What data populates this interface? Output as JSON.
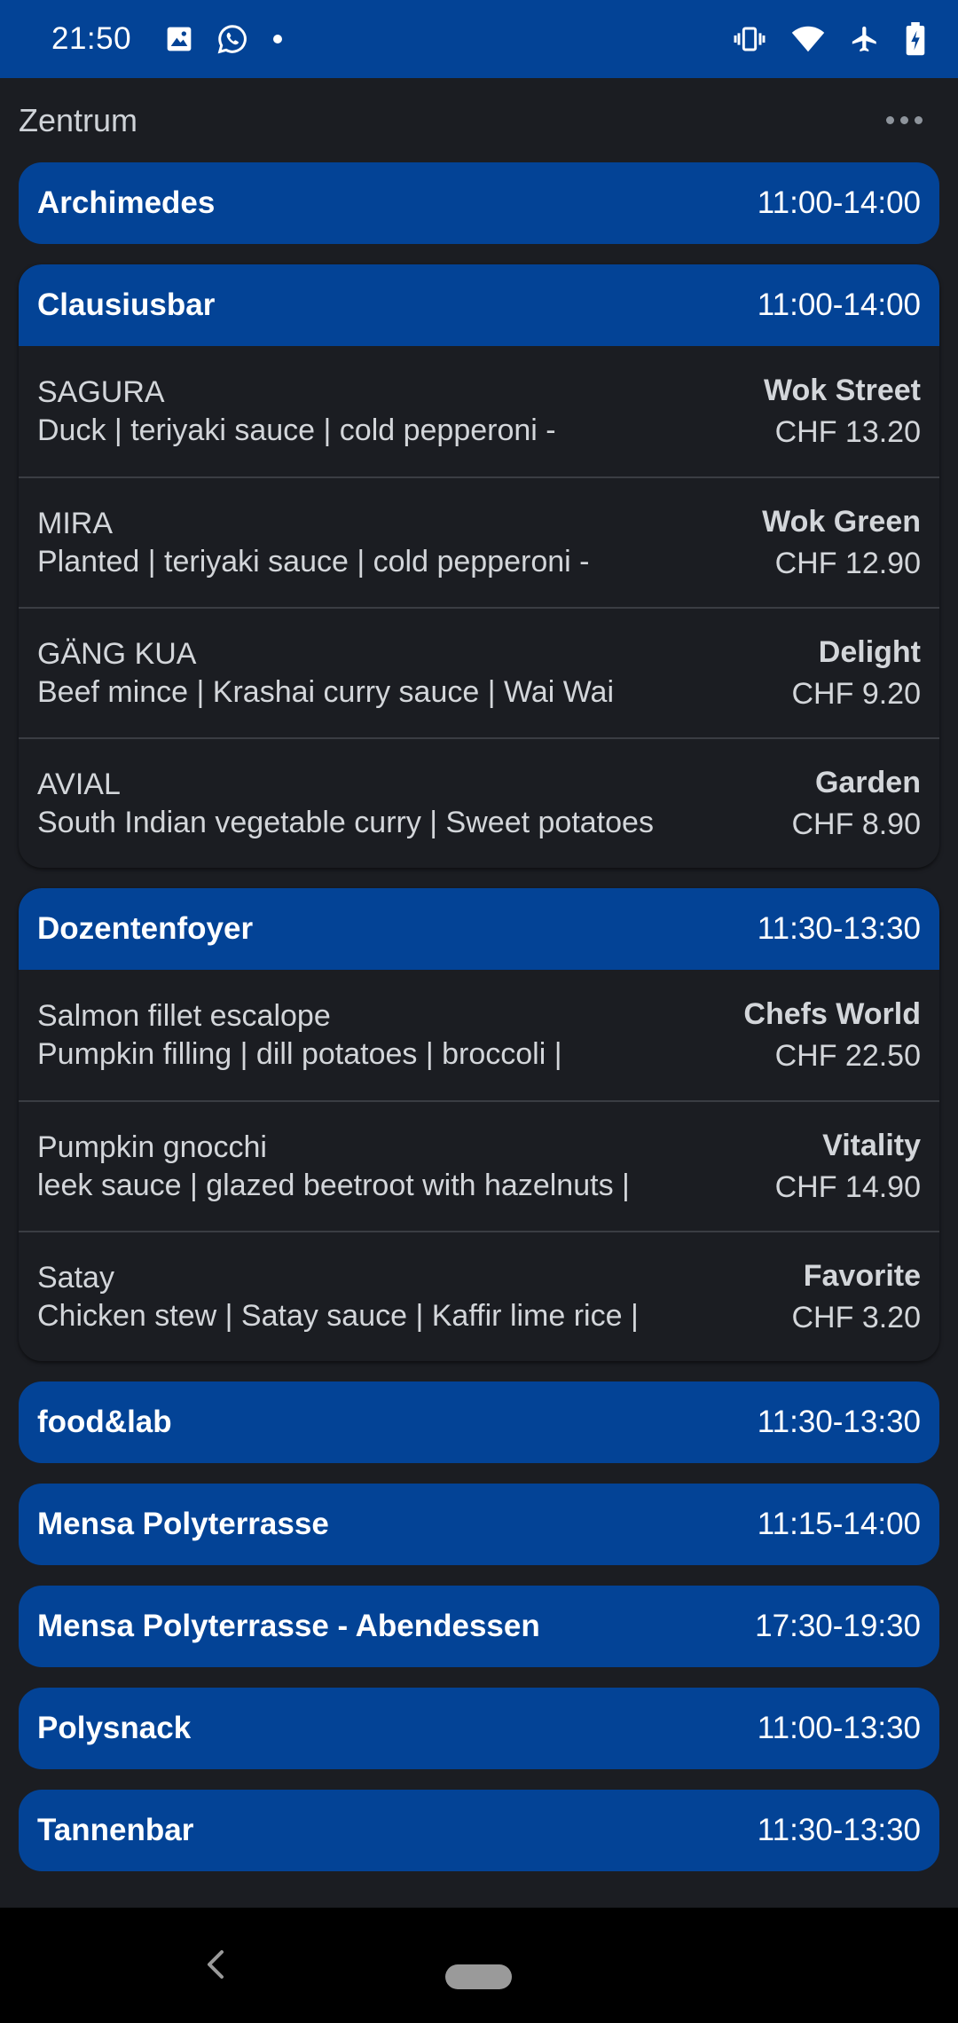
{
  "status_bar": {
    "time": "21:50",
    "left_icons": [
      "image-icon",
      "whatsapp-icon",
      "dot-icon"
    ],
    "right_icons": [
      "vibrate-icon",
      "wifi-icon",
      "airplane-icon",
      "battery-charging-icon"
    ]
  },
  "header": {
    "title": "Zentrum",
    "menu_icon": "more-horizontal-icon"
  },
  "colors": {
    "accent": "#034396",
    "background": "#1b1d22",
    "text": "#d3d6da"
  },
  "restaurants": [
    {
      "name": "Archimedes",
      "hours": "11:00-14:00",
      "items": []
    },
    {
      "name": "Clausiusbar",
      "hours": "11:00-14:00",
      "items": [
        {
          "name": "SAGURA",
          "description": "Duck | teriyaki sauce | cold pepperoni -",
          "line": "Wok Street",
          "price": "CHF 13.20"
        },
        {
          "name": "MIRA",
          "description": "Planted | teriyaki sauce | cold pepperoni -",
          "line": "Wok Green",
          "price": "CHF 12.90"
        },
        {
          "name": "GÄNG KUA",
          "description": "Beef mince | Krashai curry sauce | Wai Wai",
          "line": "Delight",
          "price": "CHF 9.20"
        },
        {
          "name": "AVIAL",
          "description": "South Indian vegetable curry | Sweet potatoes",
          "line": "Garden",
          "price": "CHF 8.90"
        }
      ]
    },
    {
      "name": "Dozentenfoyer",
      "hours": "11:30-13:30",
      "items": [
        {
          "name": "Salmon fillet escalope",
          "description": "Pumpkin filling | dill potatoes | broccoli |",
          "line": "Chefs World",
          "price": "CHF 22.50"
        },
        {
          "name": "Pumpkin gnocchi",
          "description": "leek sauce | glazed beetroot with hazelnuts |",
          "line": "Vitality",
          "price": "CHF 14.90"
        },
        {
          "name": "Satay",
          "description": "Chicken stew | Satay sauce | Kaffir lime rice |",
          "line": "Favorite",
          "price": "CHF 3.20"
        }
      ]
    },
    {
      "name": "food&lab",
      "hours": "11:30-13:30",
      "items": []
    },
    {
      "name": "Mensa Polyterrasse",
      "hours": "11:15-14:00",
      "items": []
    },
    {
      "name": "Mensa Polyterrasse - Abendessen",
      "hours": "17:30-19:30",
      "items": []
    },
    {
      "name": "Polysnack",
      "hours": "11:00-13:30",
      "items": []
    },
    {
      "name": "Tannenbar",
      "hours": "11:30-13:30",
      "items": []
    }
  ],
  "nav_bar": {
    "back_icon": "back-chevron-icon",
    "home_icon": "home-pill-icon"
  }
}
